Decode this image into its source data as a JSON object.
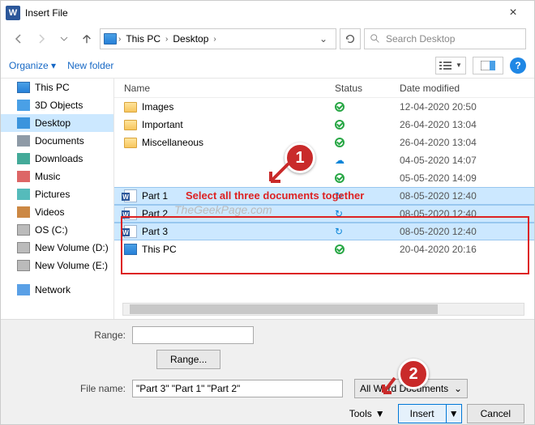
{
  "title": "Insert File",
  "breadcrumb": {
    "root": "This PC",
    "folder": "Desktop"
  },
  "search": {
    "placeholder": "Search Desktop"
  },
  "toolbar": {
    "organize": "Organize",
    "newfolder": "New folder"
  },
  "sidebar": {
    "items": [
      "This PC",
      "3D Objects",
      "Desktop",
      "Documents",
      "Downloads",
      "Music",
      "Pictures",
      "Videos",
      "OS (C:)",
      "New Volume (D:)",
      "New Volume (E:)",
      "Network"
    ]
  },
  "columns": {
    "name": "Name",
    "status": "Status",
    "date": "Date modified"
  },
  "rows": [
    {
      "name": "Images",
      "type": "folder",
      "status": "ok",
      "date": "12-04-2020 20:50"
    },
    {
      "name": "Important",
      "type": "folder",
      "status": "ok",
      "date": "26-04-2020 13:04"
    },
    {
      "name": "Miscellaneous",
      "type": "folder",
      "status": "ok",
      "date": "26-04-2020 13:04"
    },
    {
      "name": "",
      "type": "blank",
      "status": "cloud",
      "date": "04-05-2020 14:07"
    },
    {
      "name": "",
      "type": "blank",
      "status": "ok",
      "date": "05-05-2020 14:09"
    },
    {
      "name": "Part 1",
      "type": "word",
      "status": "sync",
      "date": "08-05-2020 12:40",
      "selected": true
    },
    {
      "name": "Part 2",
      "type": "word",
      "status": "sync",
      "date": "08-05-2020 12:40",
      "selected": true
    },
    {
      "name": "Part 3",
      "type": "word",
      "status": "sync",
      "date": "08-05-2020 12:40",
      "selected": true
    },
    {
      "name": "This PC",
      "type": "pc",
      "status": "ok",
      "date": "20-04-2020 20:16"
    }
  ],
  "range": {
    "label": "Range:",
    "button": "Range..."
  },
  "filename": {
    "label": "File name:",
    "value": "\"Part 3\" \"Part 1\" \"Part 2\""
  },
  "filetype": "All Word Documents",
  "actions": {
    "tools": "Tools",
    "insert": "Insert",
    "cancel": "Cancel"
  },
  "annotations": {
    "c1": "1",
    "c2": "2",
    "text": "Select all three documents together",
    "watermark": "TheGeekPage.com"
  }
}
